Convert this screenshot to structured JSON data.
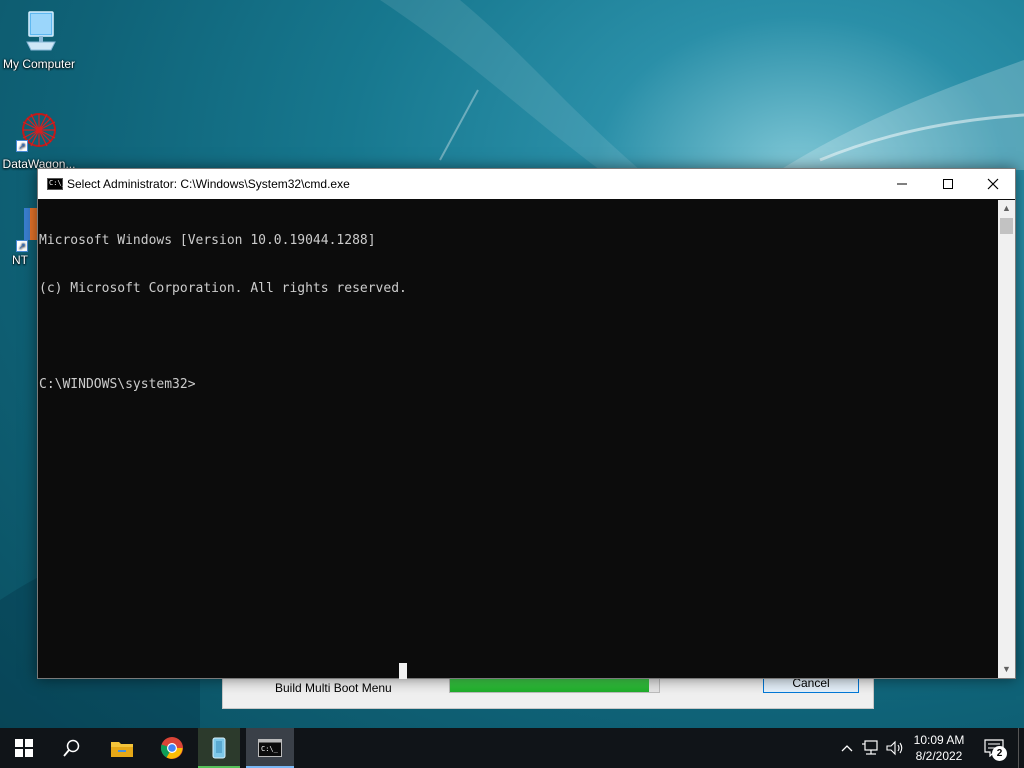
{
  "desktop": {
    "icons": [
      {
        "label": "My Computer"
      },
      {
        "label": "DataWagon..."
      },
      {
        "label": "NT"
      }
    ]
  },
  "background_dialog": {
    "operation_label": "Build Multi Boot Menu",
    "progress_fraction": 0.95,
    "cancel_label": "Cancel"
  },
  "cmd_window": {
    "title": "Select Administrator: C:\\Windows\\System32\\cmd.exe",
    "lines": [
      "Microsoft Windows [Version 10.0.19044.1288]",
      "(c) Microsoft Corporation. All rights reserved.",
      "",
      "C:\\WINDOWS\\system32>"
    ],
    "background_color": "#0c0c0c",
    "text_color": "#cccccc"
  },
  "taskbar": {
    "time": "10:09 AM",
    "date": "8/2/2022",
    "notification_count": "2",
    "accent_color": "#7ab8f5"
  }
}
